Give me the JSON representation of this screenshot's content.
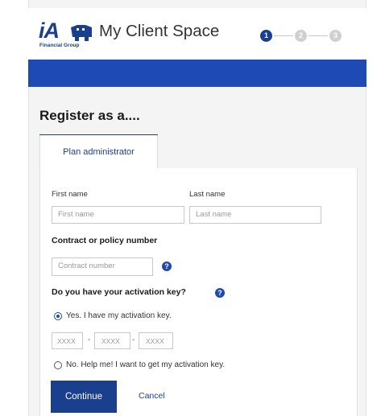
{
  "brand": {
    "logo_text": "iA",
    "logo_subtitle": "Financial Group",
    "app_title": "My Client Space",
    "primary_color": "#1b3f8f",
    "bar_color": "#1e4ab5"
  },
  "stepper": {
    "steps": [
      "1",
      "2",
      "3"
    ],
    "current_step": 1
  },
  "page": {
    "heading": "Register as a....",
    "tab_label": "Plan administrator"
  },
  "form": {
    "first_name_label": "First name",
    "first_name_placeholder": "First name",
    "last_name_label": "Last name",
    "last_name_placeholder": "Last name",
    "contract_label": "Contract or policy number",
    "contract_placeholder": "Contract number",
    "activation_question": "Do you have your activation key?",
    "option_yes": "Yes. I have my activation key.",
    "option_no": "No. Help me! I want to get my activation key.",
    "key_placeholder_1": "XXXX",
    "key_placeholder_2": "XXXX",
    "key_placeholder_3": "XXXX",
    "dash": "-",
    "help_glyph": "?"
  },
  "actions": {
    "continue_label": "Continue",
    "cancel_label": "Cancel"
  },
  "icons": {
    "help": "question-circle-icon",
    "logo_mark": "elephant-logo-icon"
  }
}
